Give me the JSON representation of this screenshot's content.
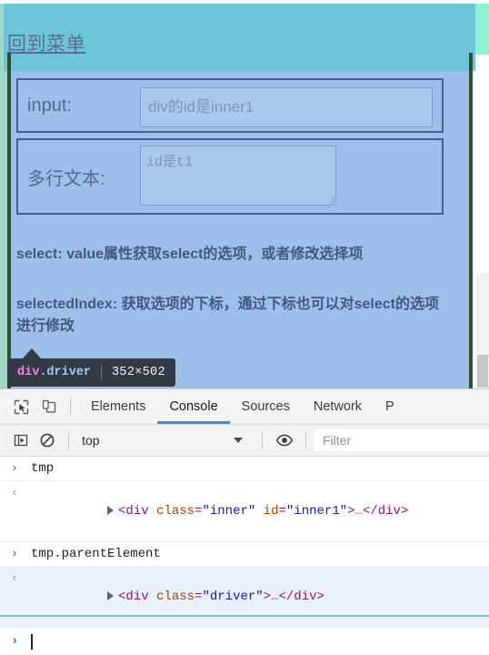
{
  "page": {
    "menu_link": "回到菜单",
    "fields": [
      {
        "label": "input:",
        "placeholder": "div的id是inner1",
        "value": ""
      },
      {
        "label": "多行文本:",
        "placeholder": "id是t1",
        "value": ""
      }
    ],
    "notes": [
      "select: value属性获取select的选项，或者修改选择项",
      "selectedIndex: 获取选项的下标，通过下标也可以对select的选项进行修改"
    ]
  },
  "inspect_tooltip": {
    "tag": "div",
    "class": ".driver",
    "dimensions": "352×502"
  },
  "devtools": {
    "icons": {
      "inspect": "inspect-element-icon",
      "device": "device-toolbar-icon",
      "sidebar": "console-sidebar-icon",
      "clear": "clear-console-icon",
      "eye": "live-expression-eye-icon"
    },
    "tabs": [
      {
        "label": "Elements",
        "active": false
      },
      {
        "label": "Console",
        "active": true
      },
      {
        "label": "Sources",
        "active": false
      },
      {
        "label": "Network",
        "active": false
      },
      {
        "label": "P",
        "active": false
      }
    ],
    "console_toolbar": {
      "context": "top",
      "filter_placeholder": "Filter",
      "filter_value": ""
    },
    "console_log": [
      {
        "kind": "input",
        "gutter": "›",
        "text": "tmp"
      },
      {
        "kind": "result",
        "gutter": "‹",
        "html": {
          "open_lt": "<",
          "tag": "div",
          "attr1_name": " class",
          "attr1_eq": "=",
          "attr1_val": "\"inner\"",
          "attr2_name": " id",
          "attr2_eq": "=",
          "attr2_val": "\"inner1\"",
          "close_gt": ">",
          "ellipsis": "…",
          "close_tag": "</div>"
        }
      },
      {
        "kind": "input",
        "gutter": "›",
        "text": "tmp.parentElement"
      },
      {
        "kind": "result",
        "highlighted": true,
        "gutter": "‹",
        "html": {
          "open_lt": "<",
          "tag": "div",
          "attr1_name": " class",
          "attr1_eq": "=",
          "attr1_val": "\"driver\"",
          "attr2_name": "",
          "attr2_eq": "",
          "attr2_val": "",
          "close_gt": ">",
          "ellipsis": "…",
          "close_tag": "</div>"
        }
      }
    ],
    "prompt": {
      "caret": "›",
      "value": ""
    }
  },
  "colors": {
    "highlight_teal": "#6ec5d8",
    "page_blue": "#9cc0ea",
    "field_border": "#43618c",
    "tooltip_bg": "#343a45",
    "tooltip_tag": "#ff7de9",
    "tooltip_class": "#9ad0f5",
    "active_tab": "#3b8ee0",
    "margin_green": "#2f4f33"
  }
}
